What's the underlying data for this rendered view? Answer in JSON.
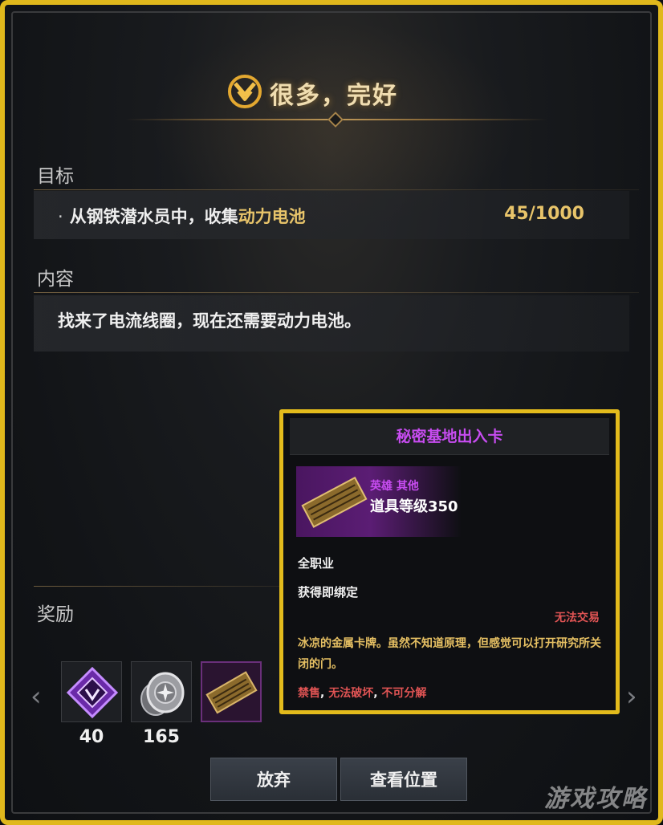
{
  "header": {
    "title": "很多，完好"
  },
  "goal": {
    "label": "目标",
    "bullet": "·",
    "text_prefix": "从钢铁潜水员中，收集",
    "text_highlight": "动力电池",
    "progress": "45/1000"
  },
  "content": {
    "label": "内容",
    "text": "找来了电流线圈，现在还需要动力电池。"
  },
  "rewards": {
    "label": "奖励",
    "items": [
      {
        "icon": "purple-crystal-icon",
        "count": "40"
      },
      {
        "icon": "silver-coin-icon",
        "count": "165"
      },
      {
        "icon": "access-card-icon",
        "count": ""
      }
    ],
    "prev_arrow": "‹",
    "next_arrow": "›"
  },
  "buttons": {
    "abandon": "放弃",
    "view_location": "查看位置"
  },
  "tooltip": {
    "name": "秘密基地出入卡",
    "rarity": "英雄 其他",
    "item_level": "道具等级350",
    "class": "全职业",
    "bind": "获得即绑定",
    "trade": "无法交易",
    "description": "冰凉的金属卡牌。虽然不知道原理，但感觉可以打开研究所关闭的门。",
    "flags": [
      "禁售",
      "无法破坏",
      "不可分解"
    ],
    "flag_separator": ", "
  },
  "watermark": "游戏攻略",
  "colors": {
    "frame": "#e0b81c",
    "hero_purple": "#c74cf0",
    "gold_text": "#e8c46a",
    "warn_red": "#e05454"
  }
}
